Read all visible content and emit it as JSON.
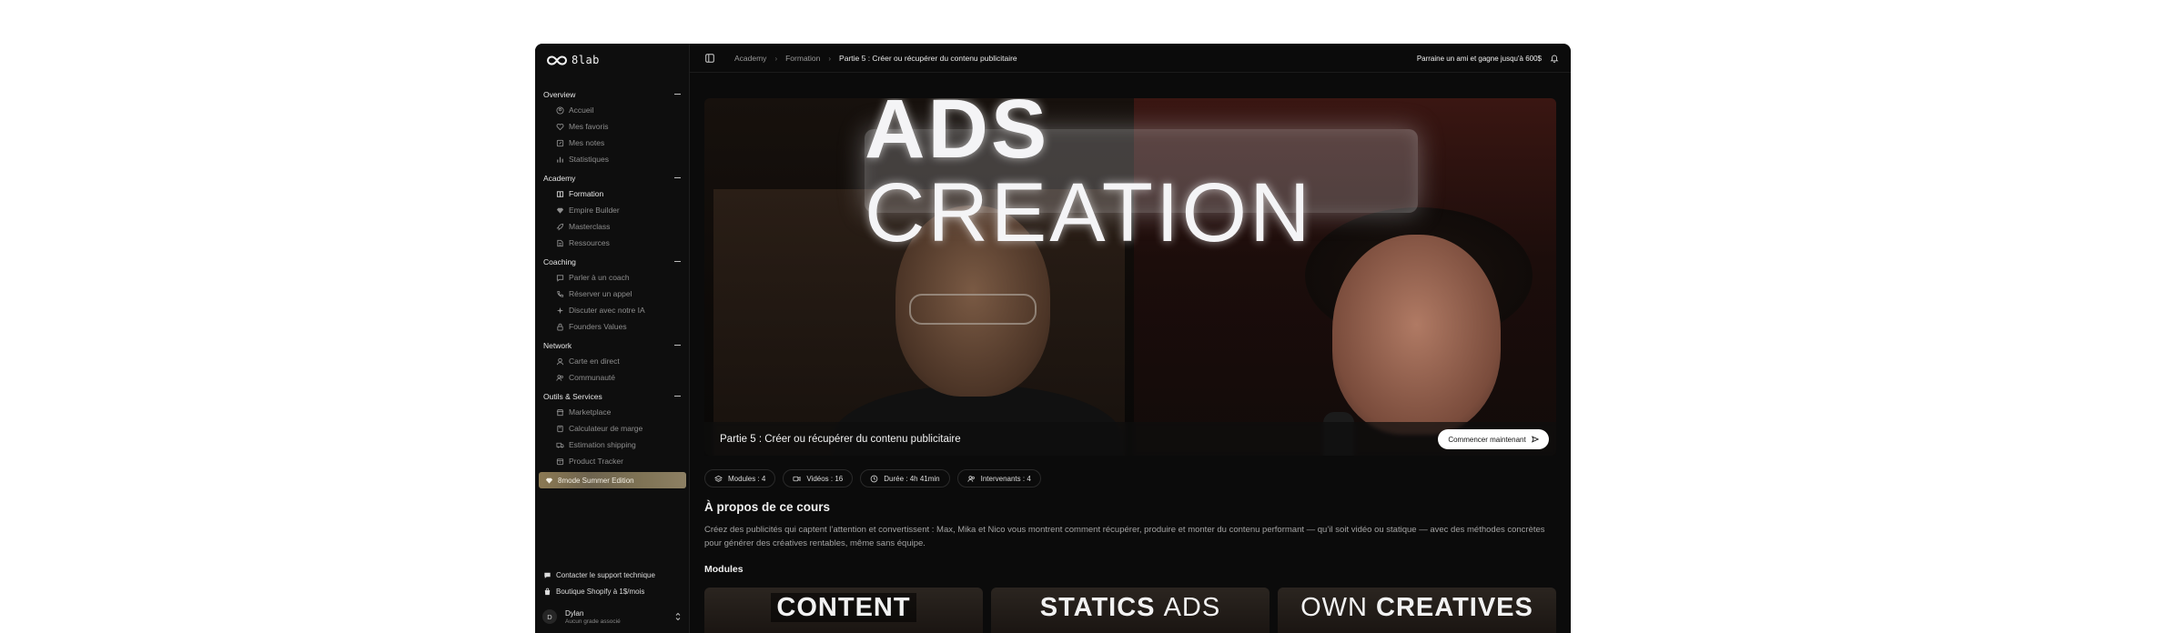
{
  "brand": {
    "logo_text": "8lab"
  },
  "sidebar": {
    "sections": [
      {
        "title": "Overview",
        "items": [
          {
            "label": "Accueil",
            "icon": "home-icon"
          },
          {
            "label": "Mes favoris",
            "icon": "heart-icon"
          },
          {
            "label": "Mes notes",
            "icon": "note-icon"
          },
          {
            "label": "Statistiques",
            "icon": "chart-icon"
          }
        ]
      },
      {
        "title": "Academy",
        "items": [
          {
            "label": "Formation",
            "icon": "book-icon",
            "active": true
          },
          {
            "label": "Empire Builder",
            "icon": "diamond-icon"
          },
          {
            "label": "Masterclass",
            "icon": "rocket-icon"
          },
          {
            "label": "Ressources",
            "icon": "file-icon"
          }
        ]
      },
      {
        "title": "Coaching",
        "items": [
          {
            "label": "Parler à un coach",
            "icon": "chat-icon"
          },
          {
            "label": "Réserver un appel",
            "icon": "phone-icon"
          },
          {
            "label": "Discuter avec notre IA",
            "icon": "sparkle-icon"
          },
          {
            "label": "Founders Values",
            "icon": "lock-icon"
          }
        ]
      },
      {
        "title": "Network",
        "items": [
          {
            "label": "Carte en direct",
            "icon": "map-pin-icon"
          },
          {
            "label": "Communauté",
            "icon": "users-icon"
          }
        ]
      },
      {
        "title": "Outils & Services",
        "items": [
          {
            "label": "Marketplace",
            "icon": "store-icon"
          },
          {
            "label": "Calculateur de marge",
            "icon": "calculator-icon"
          },
          {
            "label": "Estimation shipping",
            "icon": "truck-icon"
          },
          {
            "label": "Product Tracker",
            "icon": "box-icon"
          }
        ]
      }
    ],
    "promo": {
      "label": "8mode Summer Edition",
      "icon": "gem-icon"
    },
    "bottom_links": [
      {
        "label": "Contacter le support technique",
        "icon": "support-icon"
      },
      {
        "label": "Boutique Shopify à 1$/mois",
        "icon": "shopping-bag-icon"
      }
    ],
    "user": {
      "initial": "D",
      "name": "Dylan",
      "role": "Aucun grade associé"
    }
  },
  "topbar": {
    "breadcrumbs": [
      "Academy",
      "Formation",
      "Partie 5 : Créer ou récupérer du contenu publicitaire"
    ],
    "referral": "Parraine un ami et gagne jusqu'à 600$"
  },
  "hero": {
    "neon_bold": "ADS",
    "neon_light": "CREATION",
    "title": "Partie 5 : Créer ou récupérer du contenu publicitaire",
    "cta": "Commencer maintenant"
  },
  "chips": [
    {
      "label": "Modules : 4",
      "icon": "layers-icon"
    },
    {
      "label": "Vidéos : 16",
      "icon": "video-icon"
    },
    {
      "label": "Durée : 4h 41min",
      "icon": "clock-icon"
    },
    {
      "label": "Intervenants : 4",
      "icon": "users-icon"
    }
  ],
  "about": {
    "title": "À propos de ce cours",
    "text": "Créez des publicités qui captent l’attention et convertissent : Max, Mika et Nico vous montrent comment récupérer, produire et monter du contenu performant — qu’il soit vidéo ou statique — avec des méthodes concrètes pour générer des créatives rentables, même sans équipe."
  },
  "modules": {
    "title": "Modules",
    "cards": [
      {
        "bold": "CONTENT",
        "light": ""
      },
      {
        "bold": "STATICS",
        "light": "ADS"
      },
      {
        "bold": "CREATIVES",
        "light": "OWN"
      }
    ]
  },
  "colors": {
    "background": "#0b0b0b",
    "sidebar": "#0e0e0e",
    "promo": "#7f7355",
    "cta_bg": "#ffffff"
  }
}
